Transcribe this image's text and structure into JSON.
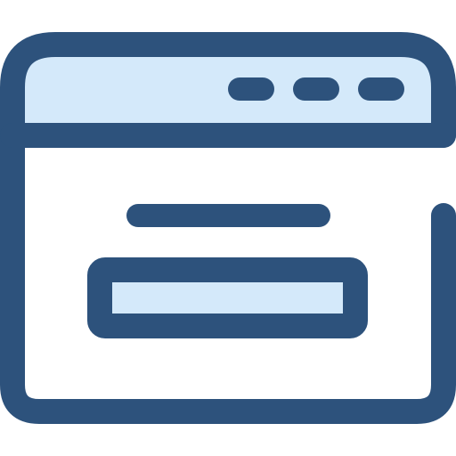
{
  "icon": {
    "name": "browser-window-icon",
    "colors": {
      "stroke": "#2D527C",
      "fill_light": "#D4E9FA",
      "background": "#FFFFFF"
    },
    "title_bar_dots": 3
  }
}
